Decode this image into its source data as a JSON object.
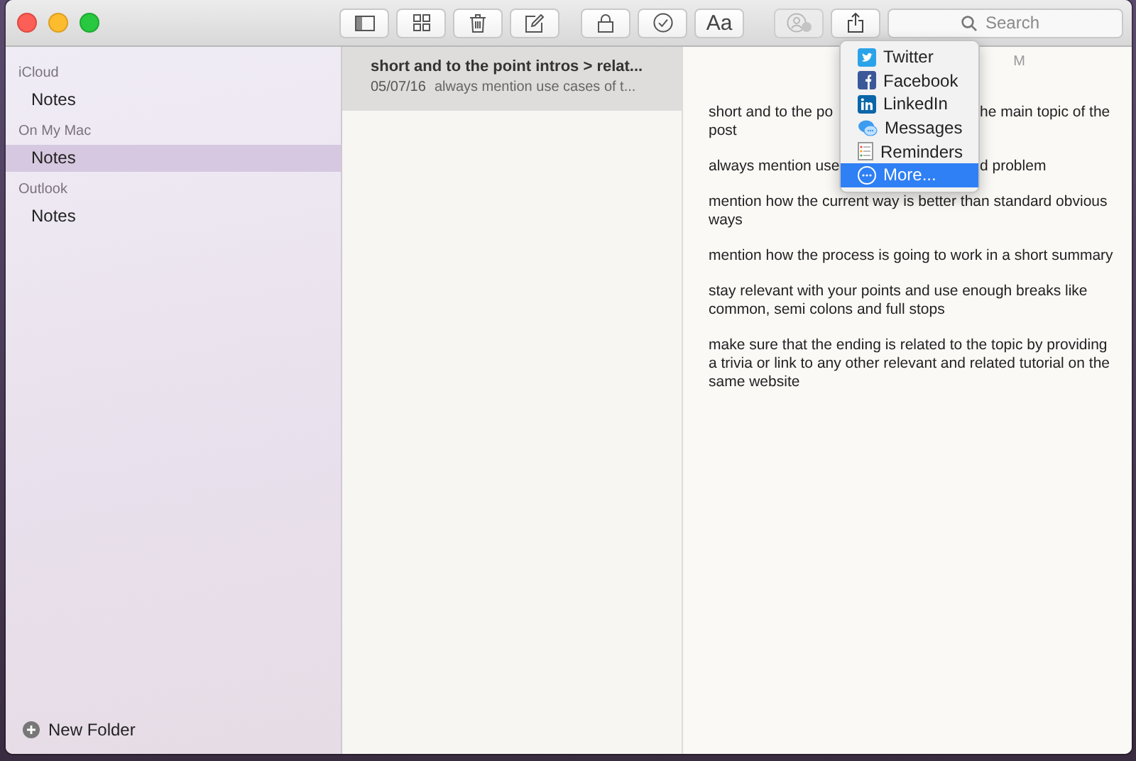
{
  "toolbar": [
    {
      "kind": "sidebar",
      "disabled": false
    },
    {
      "kind": "grid",
      "disabled": false
    },
    {
      "kind": "trash",
      "disabled": false
    },
    {
      "kind": "compose",
      "disabled": false
    },
    {
      "kind": "lock",
      "disabled": false
    },
    {
      "kind": "check",
      "disabled": false
    },
    {
      "kind": "text",
      "label": "Aa",
      "disabled": false
    },
    {
      "kind": "add-person",
      "disabled": true
    },
    {
      "kind": "share",
      "disabled": false
    }
  ],
  "search": {
    "placeholder": "Search"
  },
  "sidebar": {
    "groups": [
      {
        "header": "iCloud",
        "items": [
          {
            "label": "Notes",
            "selected": false
          }
        ]
      },
      {
        "header": "On My Mac",
        "items": [
          {
            "label": "Notes",
            "selected": true
          }
        ]
      },
      {
        "header": "Outlook",
        "items": [
          {
            "label": "Notes",
            "selected": false
          }
        ]
      }
    ],
    "footer": "New Folder"
  },
  "notes": [
    {
      "title": "short and to the point intros > relat...",
      "date": "05/07/16",
      "preview": "always mention use cases of t...",
      "selected": true
    }
  ],
  "note": {
    "date": "M",
    "paragraphs": [
      {
        "lines": [
          {
            "text": "short and to the po",
            "after_gap": "he main topic of the"
          },
          {
            "text": "post"
          }
        ]
      },
      {
        "lines": [
          {
            "text": "always mention use",
            "after_gap": "d problem"
          }
        ]
      },
      {
        "lines": [
          {
            "text": "mention how the current way is better than standard obvious"
          },
          {
            "text": "ways"
          }
        ]
      },
      {
        "lines": [
          {
            "text": "mention how the process is going to work in a short summary"
          }
        ]
      },
      {
        "lines": [
          {
            "text": "stay relevant with your points and use enough breaks like"
          },
          {
            "text": "common, semi colons and full stops"
          }
        ]
      },
      {
        "lines": [
          {
            "text": "make sure that the ending is related to the topic by providing"
          },
          {
            "text": "a trivia or link to any other relevant and related tutorial on the"
          },
          {
            "text": "same website"
          }
        ]
      }
    ]
  },
  "share_menu": [
    {
      "kind": "twitter",
      "label": "Twitter",
      "selected": false
    },
    {
      "kind": "facebook",
      "label": "Facebook",
      "selected": false
    },
    {
      "kind": "linkedin",
      "label": "LinkedIn",
      "selected": false
    },
    {
      "kind": "messages",
      "label": "Messages",
      "selected": false
    },
    {
      "kind": "reminders",
      "label": "Reminders",
      "selected": false
    },
    {
      "kind": "more",
      "label": "More...",
      "selected": true
    }
  ]
}
